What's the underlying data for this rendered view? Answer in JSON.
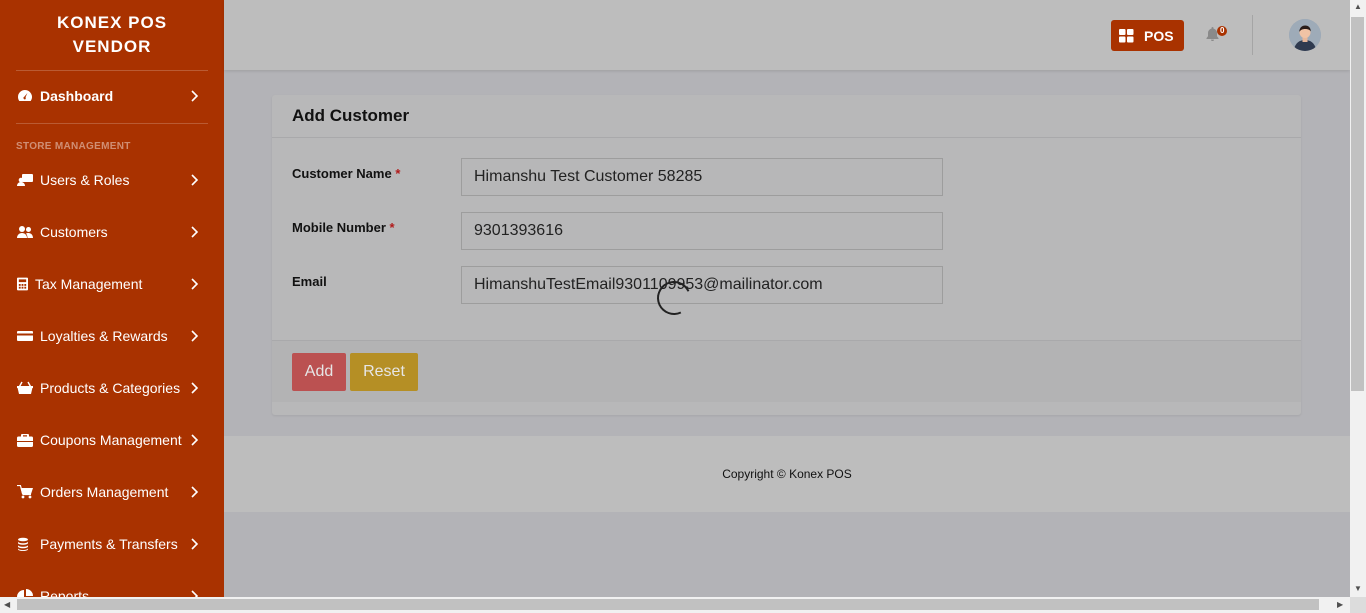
{
  "brand": {
    "line1": "KONEX POS",
    "line2": "VENDOR"
  },
  "sidebar": {
    "dashboard": {
      "label": "Dashboard",
      "icon": "tachometer-icon"
    },
    "section_heading": "STORE MANAGEMENT",
    "items": [
      {
        "label": "Users & Roles",
        "icon": "user-roles-icon"
      },
      {
        "label": "Customers",
        "icon": "users-icon"
      },
      {
        "label": "Tax Management",
        "icon": "calculator-icon"
      },
      {
        "label": "Loyalties & Rewards",
        "icon": "credit-card-icon"
      },
      {
        "label": "Products & Categories",
        "icon": "basket-icon"
      },
      {
        "label": "Coupons Management",
        "icon": "briefcase-icon"
      },
      {
        "label": "Orders Management",
        "icon": "cart-icon"
      },
      {
        "label": "Payments & Transfers",
        "icon": "coins-icon"
      },
      {
        "label": "Reports",
        "icon": "chart-icon"
      }
    ]
  },
  "topbar": {
    "pos_label": "POS",
    "notification_count": "0"
  },
  "form": {
    "title": "Add Customer",
    "fields": [
      {
        "label": "Customer Name",
        "required": "*",
        "value": "Himanshu Test Customer 58285"
      },
      {
        "label": "Mobile Number",
        "required": "*",
        "value": "9301393616"
      },
      {
        "label": "Email",
        "required": "",
        "value": "HimanshuTestEmail9301109953@mailinator.com"
      }
    ],
    "add_label": "Add",
    "reset_label": "Reset"
  },
  "footer": {
    "copyright": "Copyright © Konex POS"
  },
  "colors": {
    "sidebar": "#a93200",
    "accent": "#a93200",
    "add_button": "#bb5151",
    "reset_button": "#b58f25"
  }
}
